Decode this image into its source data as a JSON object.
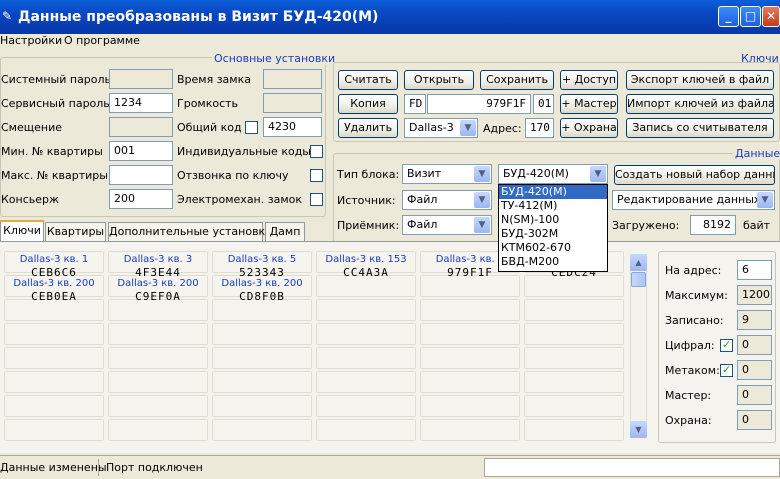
{
  "window": {
    "title": "Данные преобразованы в Визит БУД-420(М)",
    "icon": "pencil-icon"
  },
  "menu": [
    "Настройки",
    "О программе"
  ],
  "basic": {
    "title": "Основные установки",
    "system_pass_label": "Системный пароль",
    "service_pass_label": "Сервисный пароль",
    "service_pass": "1234",
    "offset_label": "Смещение",
    "min_apt_label": "Мин. № квартиры",
    "min_apt": "001",
    "max_apt_label": "Макс. № квартиры",
    "concierge_label": "Консьерж",
    "concierge": "200",
    "lock_time_label": "Время замка",
    "volume_label": "Громкость",
    "common_code_label": "Общий код",
    "common_code": "4230",
    "indiv_codes_label": "Индивидуальные коды",
    "key_response_label": "Отзвонка по ключу",
    "em_lock_label": "Электромехан. замок"
  },
  "keys": {
    "title": "Ключи",
    "read": "Считать",
    "open": "Открыть",
    "save": "Сохранить",
    "access": "+ Доступ",
    "export": "Экспорт ключей в файл",
    "copy": "Копия",
    "code_prefix": "FD",
    "code": "979F1F",
    "code_suffix": "01",
    "master": "+ Мастер",
    "import": "Импорт ключей из файла",
    "delete": "Удалить",
    "key_type": "Dallas-3",
    "address_label": "Адрес:",
    "address": "170",
    "guard": "+ Охрана",
    "reader": "Запись со считывателя"
  },
  "data": {
    "title": "Данные",
    "block_type_label": "Тип блока:",
    "block_type": "Визит",
    "model": "БУД-420(М)",
    "new_set": "Создать новый набор данных",
    "source_label": "Источник:",
    "source": "Файл",
    "edit": "Редактирование данных",
    "receiver_label": "Приёмник:",
    "receiver": "Файл",
    "loaded_label": "Загружено:",
    "loaded": "8192",
    "bytes": "байт"
  },
  "dropdown": [
    "БУД-420(М)",
    "ТУ-412(М)",
    "N(SM)-100",
    "БУД-302М",
    "КТМ602-670",
    "БВД-М200"
  ],
  "tabs": [
    "Ключи",
    "Квартиры",
    "Дополнительные установки",
    "Дамп"
  ],
  "key_cells": [
    {
      "title": "Dallas-3 кв. 1",
      "code": "CEB6C6"
    },
    {
      "title": "Dallas-3 кв. 3",
      "code": "4F3E44"
    },
    {
      "title": "Dallas-3 кв. 5",
      "code": "523343"
    },
    {
      "title": "Dallas-3 кв. 153",
      "code": "CC4A3A"
    },
    {
      "title": "Dallas-3 кв. 1",
      "code": "979F1F"
    },
    {
      "title": "",
      "code": "CEDC24"
    },
    {
      "title": "Dallas-3 кв. 200",
      "code": "CEB0EA"
    },
    {
      "title": "Dallas-3 кв. 200",
      "code": "C9EF0A"
    },
    {
      "title": "Dallas-3 кв. 200",
      "code": "CD8F0B"
    }
  ],
  "partial_title": "0",
  "stats": {
    "to_address_label": "На адрес:",
    "to_address": "6",
    "max_label": "Максимум:",
    "max": "1200",
    "written_label": "Записано:",
    "written": "9",
    "digital_label": "Цифрал:",
    "digital": "0",
    "metakom_label": "Метаком:",
    "metakom": "0",
    "master_label": "Мастер:",
    "master": "0",
    "guard_label": "Охрана:",
    "guard": "0"
  },
  "status": {
    "changed": "Данные изменены",
    "port": "Порт подключен"
  }
}
